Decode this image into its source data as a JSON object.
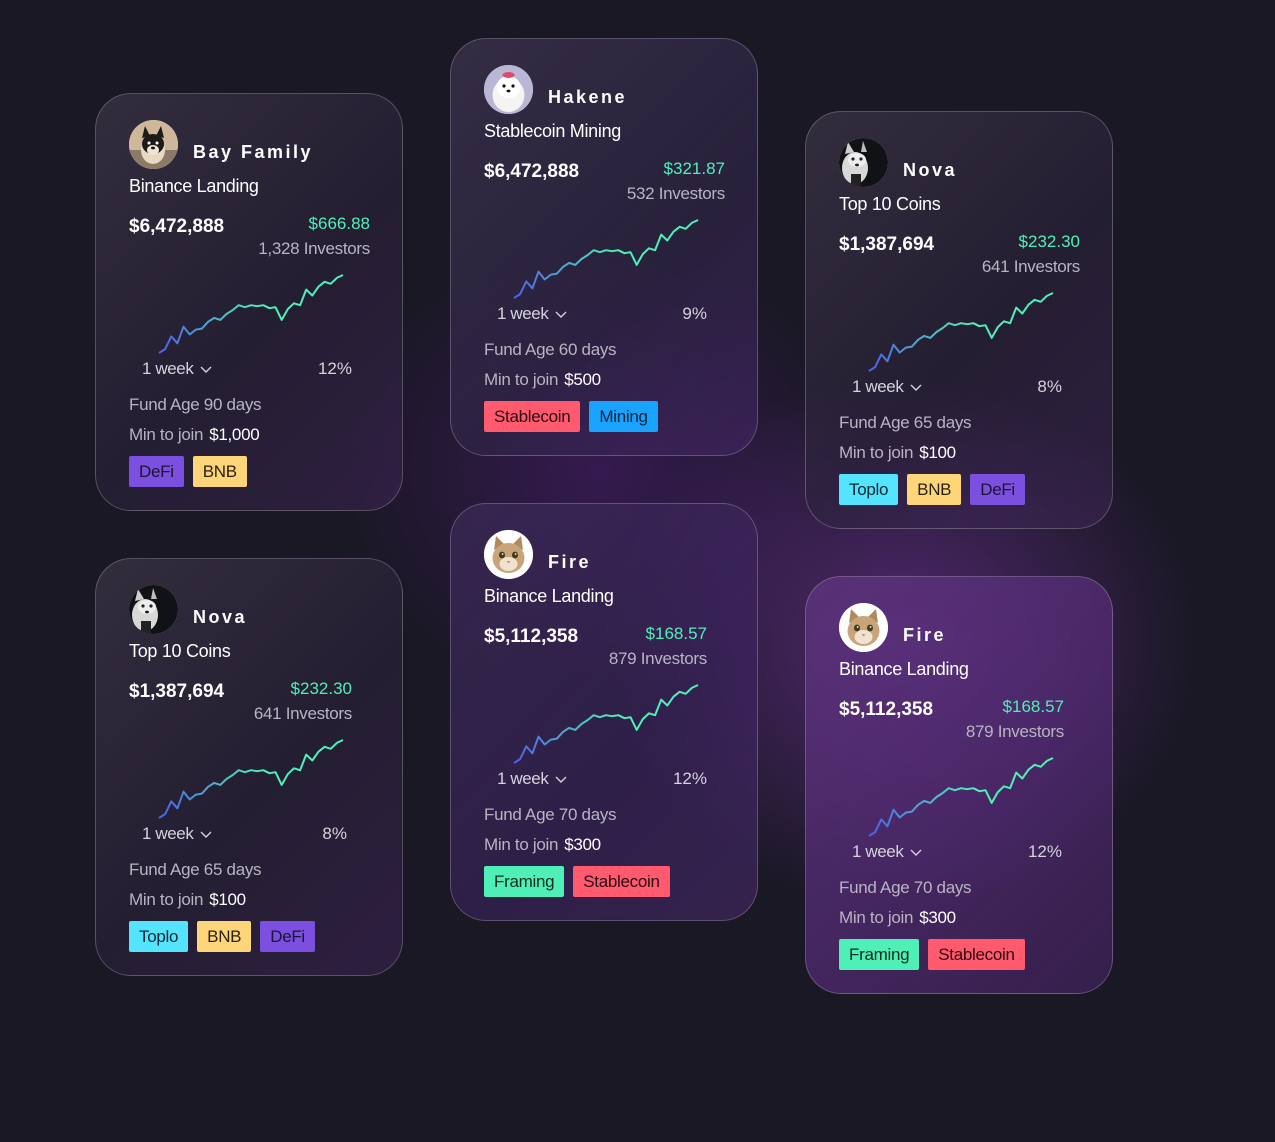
{
  "colors": {
    "DeFi": {
      "bg": "#7b4fe0",
      "fg": "#1c1430"
    },
    "BNB": {
      "bg": "#ffd57a",
      "fg": "#2a2010"
    },
    "Stablecoin": {
      "bg": "#ff5a6e",
      "fg": "#2a0c12"
    },
    "Mining": {
      "bg": "#18a3ff",
      "fg": "#06233a"
    },
    "Toplo": {
      "bg": "#55e4ff",
      "fg": "#062a33"
    },
    "Framing": {
      "bg": "#4ff0b8",
      "fg": "#0a2e22"
    },
    "change_green": "#4ff0b8",
    "line_start": "#4f5fe8",
    "line_end": "#4ff0b8"
  },
  "cards": [
    {
      "name": "Bay Family",
      "fund": "Binance Landing",
      "value": "$6,472,888",
      "change": "$666.88",
      "investors": "1,328 Investors",
      "period": "1 week",
      "pct": "12%",
      "age": "Fund Age 90 days",
      "min_label": "Min to join",
      "min_value": "$1,000",
      "tags": [
        "DeFi",
        "BNB"
      ],
      "avatar_icon": "shiba-dog-avatar"
    },
    {
      "name": "Hakene",
      "fund": "Stablecoin Mining",
      "value": "$6,472,888",
      "change": "$321.87",
      "investors": "532 Investors",
      "period": "1 week",
      "pct": "9%",
      "age": "Fund Age 60 days",
      "min_label": "Min to join",
      "min_value": "$500",
      "tags": [
        "Stablecoin",
        "Mining"
      ],
      "avatar_icon": "white-dog-avatar"
    },
    {
      "name": "Nova",
      "fund": "Top 10 Coins",
      "value": "$1,387,694",
      "change": "$232.30",
      "investors": "641 Investors",
      "period": "1 week",
      "pct": "8%",
      "age": "Fund Age 65 days",
      "min_label": "Min to join",
      "min_value": "$100",
      "tags": [
        "Toplo",
        "BNB",
        "DeFi"
      ],
      "avatar_icon": "husky-avatar"
    },
    {
      "name": "Nova",
      "fund": "Top 10 Coins",
      "value": "$1,387,694",
      "change": "$232.30",
      "investors": "641 Investors",
      "period": "1 week",
      "pct": "8%",
      "age": "Fund Age 65 days",
      "min_label": "Min to join",
      "min_value": "$100",
      "tags": [
        "Toplo",
        "BNB",
        "DeFi"
      ],
      "avatar_icon": "husky-avatar"
    },
    {
      "name": "Fire",
      "fund": "Binance Landing",
      "value": "$5,112,358",
      "change": "$168.57",
      "investors": "879 Investors",
      "period": "1 week",
      "pct": "12%",
      "age": "Fund Age 70 days",
      "min_label": "Min to join",
      "min_value": "$300",
      "tags": [
        "Framing",
        "Stablecoin"
      ],
      "avatar_icon": "cat-avatar"
    },
    {
      "name": "Fire",
      "fund": "Binance Landing",
      "value": "$5,112,358",
      "change": "$168.57",
      "investors": "879 Investors",
      "period": "1 week",
      "pct": "12%",
      "age": "Fund Age 70 days",
      "min_label": "Min to join",
      "min_value": "$300",
      "tags": [
        "Framing",
        "Stablecoin"
      ],
      "avatar_icon": "cat-avatar"
    }
  ],
  "sparkline": [
    0,
    4,
    17,
    10,
    27,
    19,
    24,
    25,
    32,
    36,
    34,
    40,
    44,
    49,
    47,
    49,
    48,
    49,
    46,
    47,
    34,
    45,
    51,
    49,
    65,
    59,
    68,
    73,
    71,
    77,
    80
  ]
}
